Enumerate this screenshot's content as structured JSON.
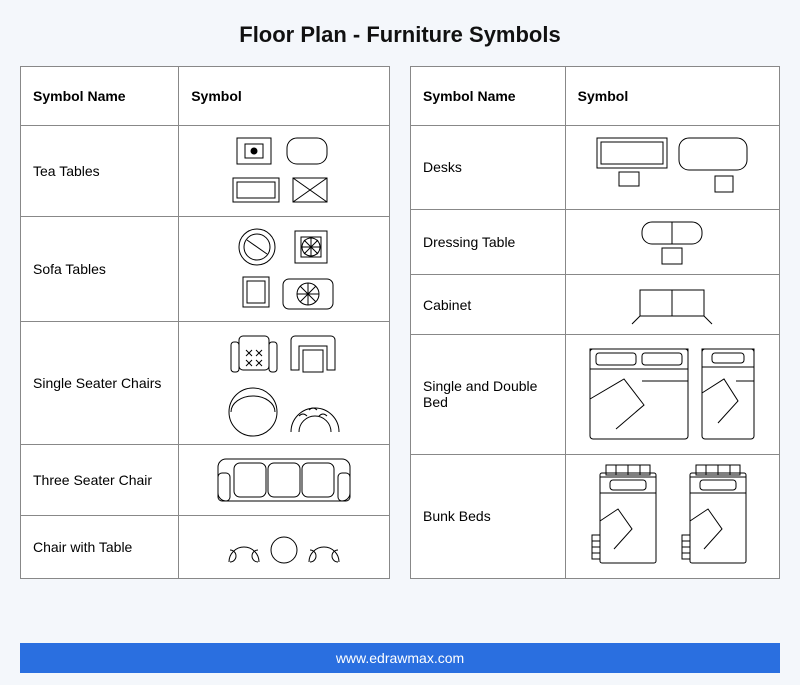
{
  "title": "Floor Plan - Furniture Symbols",
  "headers": {
    "name": "Symbol Name",
    "symbol": "Symbol"
  },
  "left_rows": [
    {
      "name": "Tea Tables",
      "icon": "tea-tables"
    },
    {
      "name": "Sofa Tables",
      "icon": "sofa-tables"
    },
    {
      "name": "Single Seater Chairs",
      "icon": "single-seater-chairs"
    },
    {
      "name": "Three Seater Chair",
      "icon": "three-seater-chair"
    },
    {
      "name": "Chair with Table",
      "icon": "chair-with-table"
    }
  ],
  "right_rows": [
    {
      "name": "Desks",
      "icon": "desks"
    },
    {
      "name": "Dressing Table",
      "icon": "dressing-table"
    },
    {
      "name": "Cabinet",
      "icon": "cabinet"
    },
    {
      "name": "Single and Double Bed",
      "icon": "single-double-bed"
    },
    {
      "name": "Bunk Beds",
      "icon": "bunk-beds"
    }
  ],
  "footer": "www.edrawmax.com"
}
